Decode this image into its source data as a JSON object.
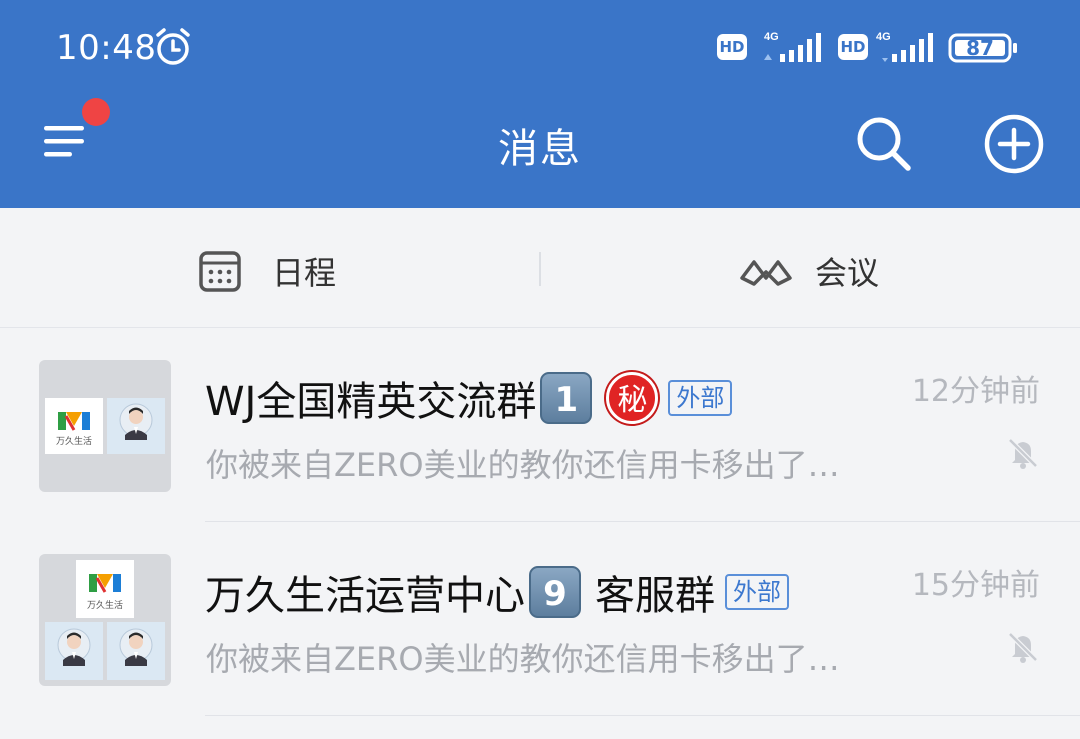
{
  "status_bar": {
    "time": "10:48",
    "battery": "87",
    "sim1": {
      "hd": "HD",
      "network": "4G"
    },
    "sim2": {
      "hd": "HD",
      "network": "4G"
    },
    "icons": [
      "alarm-icon",
      "signal-icon",
      "battery-icon"
    ]
  },
  "header": {
    "title": "消息",
    "menu_icon": "menu-icon",
    "search_icon": "search-icon",
    "add_icon": "plus-circle-icon",
    "has_notification_dot": true
  },
  "quickbar": {
    "schedule_label": "日程",
    "meeting_label": "会议"
  },
  "conversations": [
    {
      "title": "WJ全国精英交流群",
      "number_badge": "1",
      "secret_badge": "秘",
      "tag": "外部",
      "time": "12分钟前",
      "preview": "你被来自ZERO美业的教你还信用卡移出了…",
      "muted": true
    },
    {
      "title": "万久生活运营中心",
      "number_badge": "9",
      "title_suffix": "客服群",
      "tag": "外部",
      "time": "15分钟前",
      "preview": "你被来自ZERO美业的教你还信用卡移出了…",
      "muted": true
    }
  ],
  "logo": {
    "text": "万久生活"
  },
  "colors": {
    "header_bg": "#3a75c8",
    "list_bg": "#f3f4f6",
    "badge_red": "#e02424",
    "tag_blue": "#3c78cf"
  }
}
